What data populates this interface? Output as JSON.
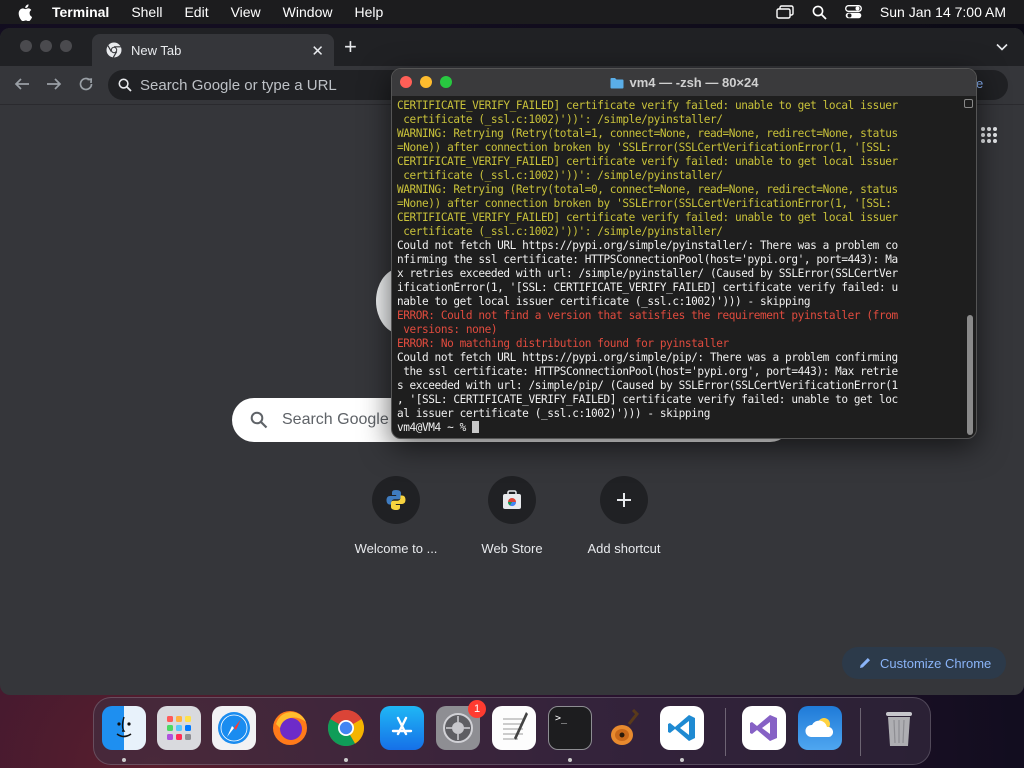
{
  "menubar": {
    "app": "Terminal",
    "items": [
      "Shell",
      "Edit",
      "View",
      "Window",
      "Help"
    ],
    "clock": "Sun Jan 14  7:00 AM"
  },
  "chrome": {
    "tab_title": "New Tab",
    "omnibox_placeholder": "Search Google or type a URL",
    "ntp_search_placeholder": "Search Google",
    "shortcuts": [
      "Welcome to ...",
      "Web Store",
      "Add shortcut"
    ],
    "customize_label": "Customize Chrome",
    "profile_chip_partial": "e"
  },
  "terminal": {
    "title": "vm4 — -zsh — 80×24",
    "lines": [
      {
        "t": "w",
        "s": "CERTIFICATE_VERIFY_FAILED] certificate verify failed: unable to get local issuer"
      },
      {
        "t": "w",
        "s": " certificate (_ssl.c:1002)'))': /simple/pyinstaller/"
      },
      {
        "t": "w",
        "s": "WARNING: Retrying (Retry(total=1, connect=None, read=None, redirect=None, status"
      },
      {
        "t": "w",
        "s": "=None)) after connection broken by 'SSLError(SSLCertVerificationError(1, '[SSL:"
      },
      {
        "t": "w",
        "s": "CERTIFICATE_VERIFY_FAILED] certificate verify failed: unable to get local issuer"
      },
      {
        "t": "w",
        "s": " certificate (_ssl.c:1002)'))': /simple/pyinstaller/"
      },
      {
        "t": "w",
        "s": "WARNING: Retrying (Retry(total=0, connect=None, read=None, redirect=None, status"
      },
      {
        "t": "w",
        "s": "=None)) after connection broken by 'SSLError(SSLCertVerificationError(1, '[SSL:"
      },
      {
        "t": "w",
        "s": "CERTIFICATE_VERIFY_FAILED] certificate verify failed: unable to get local issuer"
      },
      {
        "t": "w",
        "s": " certificate (_ssl.c:1002)'))': /simple/pyinstaller/"
      },
      {
        "t": "n",
        "s": "Could not fetch URL https://pypi.org/simple/pyinstaller/: There was a problem co"
      },
      {
        "t": "n",
        "s": "nfirming the ssl certificate: HTTPSConnectionPool(host='pypi.org', port=443): Ma"
      },
      {
        "t": "n",
        "s": "x retries exceeded with url: /simple/pyinstaller/ (Caused by SSLError(SSLCertVer"
      },
      {
        "t": "n",
        "s": "ificationError(1, '[SSL: CERTIFICATE_VERIFY_FAILED] certificate verify failed: u"
      },
      {
        "t": "n",
        "s": "nable to get local issuer certificate (_ssl.c:1002)'))) - skipping"
      },
      {
        "t": "e",
        "s": "ERROR: Could not find a version that satisfies the requirement pyinstaller (from"
      },
      {
        "t": "e",
        "s": " versions: none)"
      },
      {
        "t": "e",
        "s": "ERROR: No matching distribution found for pyinstaller"
      },
      {
        "t": "n",
        "s": "Could not fetch URL https://pypi.org/simple/pip/: There was a problem confirming"
      },
      {
        "t": "n",
        "s": " the ssl certificate: HTTPSConnectionPool(host='pypi.org', port=443): Max retrie"
      },
      {
        "t": "n",
        "s": "s exceeded with url: /simple/pip/ (Caused by SSLError(SSLCertVerificationError(1"
      },
      {
        "t": "n",
        "s": ", '[SSL: CERTIFICATE_VERIFY_FAILED] certificate verify failed: unable to get loc"
      },
      {
        "t": "n",
        "s": "al issuer certificate (_ssl.c:1002)'))) - skipping"
      }
    ],
    "prompt": "vm4@VM4 ~ % "
  },
  "dock": {
    "items": [
      "finder-icon",
      "launchpad-icon",
      "safari-icon",
      "firefox-icon",
      "chrome-icon",
      "app-store-icon",
      "system-settings-icon",
      "textedit-icon",
      "terminal-icon",
      "garageband-icon",
      "vscode-icon",
      "visual-studio-icon",
      "weather-icon",
      "trash-icon"
    ],
    "settings_badge": "1"
  },
  "colors": {
    "warning": "#c8c13a",
    "error": "#e04b3e",
    "accent_link": "#8ab4f8"
  }
}
